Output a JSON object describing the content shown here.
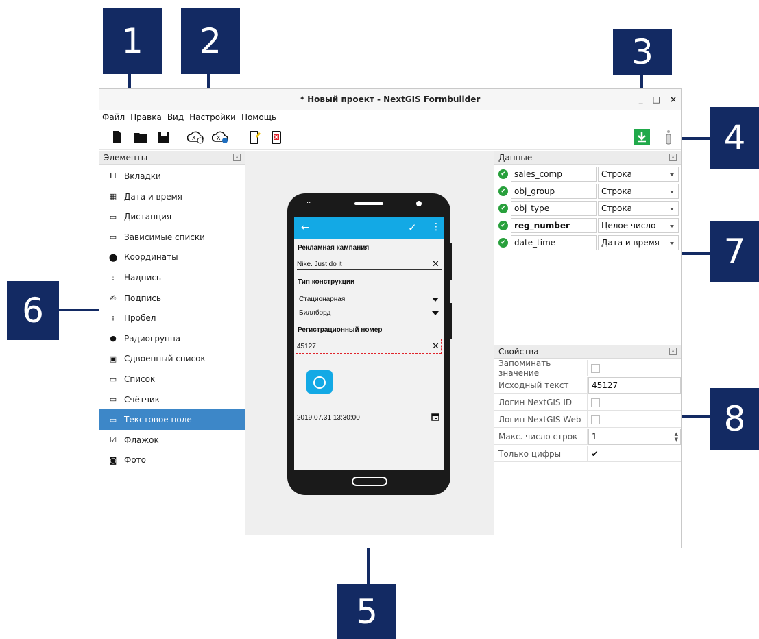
{
  "window": {
    "title": "* Новый проект - NextGIS Formbuilder",
    "min_glyph": "_",
    "max_glyph": "□",
    "close_glyph": "×"
  },
  "menu": [
    "Файл",
    "Правка",
    "Вид",
    "Настройки",
    "Помощь"
  ],
  "toolbar": {
    "icons": [
      "new-file-icon",
      "open-folder-icon",
      "save-icon",
      "ngw-upload-icon",
      "ngw-download-icon",
      "device-edit-icon",
      "device-delete-icon",
      "download-green-icon",
      "about-icon"
    ]
  },
  "elements_panel": {
    "title": "Элементы",
    "items": [
      {
        "label": "Вкладки",
        "icon": "tabs-icon",
        "glyph": "⧠"
      },
      {
        "label": "Дата и время",
        "icon": "calendar-icon",
        "glyph": "▦"
      },
      {
        "label": "Дистанция",
        "icon": "ruler-icon",
        "glyph": "▭"
      },
      {
        "label": "Зависимые списки",
        "icon": "dependent-lists-icon",
        "glyph": "▭"
      },
      {
        "label": "Координаты",
        "icon": "location-pin-icon",
        "glyph": "⬤"
      },
      {
        "label": "Надпись",
        "icon": "label-icon",
        "glyph": "⁝"
      },
      {
        "label": "Подпись",
        "icon": "signature-icon",
        "glyph": "✍"
      },
      {
        "label": "Пробел",
        "icon": "space-icon",
        "glyph": "⁝"
      },
      {
        "label": "Радиогруппа",
        "icon": "radio-icon",
        "glyph": "●"
      },
      {
        "label": "Сдвоенный список",
        "icon": "double-list-icon",
        "glyph": "▣"
      },
      {
        "label": "Список",
        "icon": "list-icon",
        "glyph": "▭"
      },
      {
        "label": "Счётчик",
        "icon": "counter-icon",
        "glyph": "▭"
      },
      {
        "label": "Текстовое поле",
        "icon": "text-field-icon",
        "glyph": "▭"
      },
      {
        "label": "Флажок",
        "icon": "checkbox-icon",
        "glyph": "☑"
      },
      {
        "label": "Фото",
        "icon": "camera-icon",
        "glyph": "◙"
      }
    ],
    "selected_index": 12
  },
  "phone": {
    "label_campaign": "Рекламная кампания",
    "value_campaign": "Nike. Just do it",
    "label_type": "Тип конструкции",
    "value_type1": "Стационарная",
    "value_type2": "Биллборд",
    "label_reg": "Регистрационный номер",
    "value_reg": "45127",
    "datetime": "2019.07.31 13:30:00",
    "clear_glyph": "✕",
    "back_glyph": "←",
    "ok_glyph": "✓",
    "more_glyph": "⋮",
    "accent": "#13a9e5"
  },
  "data_panel": {
    "title": "Данные",
    "rows": [
      {
        "field": "sales_comp",
        "type": "Строка"
      },
      {
        "field": "obj_group",
        "type": "Строка"
      },
      {
        "field": "obj_type",
        "type": "Строка"
      },
      {
        "field": "reg_number",
        "type": "Целое число",
        "bold": true
      },
      {
        "field": "date_time",
        "type": "Дата и время"
      }
    ]
  },
  "props_panel": {
    "title": "Свойства",
    "rows": [
      {
        "name": "Запоминать значение",
        "value": "",
        "kind": "checkbox",
        "checked": false
      },
      {
        "name": "Исходный текст",
        "value": "45127",
        "kind": "text"
      },
      {
        "name": "Логин NextGIS ID",
        "value": "",
        "kind": "checkbox",
        "checked": false
      },
      {
        "name": "Логин NextGIS Web",
        "value": "",
        "kind": "checkbox",
        "checked": false
      },
      {
        "name": "Макс. число строк",
        "value": "1",
        "kind": "spin"
      },
      {
        "name": "Только цифры",
        "value": "✔",
        "kind": "checkbox",
        "checked": true
      }
    ]
  },
  "callouts": [
    "1",
    "2",
    "3",
    "4",
    "5",
    "6",
    "7",
    "8"
  ],
  "colors": {
    "callout": "#132a63",
    "selection": "#3d87c8",
    "ok_green": "#28a03c"
  }
}
